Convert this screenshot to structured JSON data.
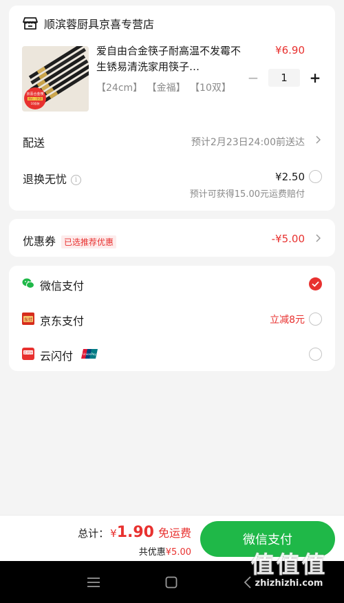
{
  "store": {
    "name": "顺滨蓉厨具京喜专营店",
    "icon": "store-icon"
  },
  "product": {
    "title": "爱自由合金筷子耐高温不发霉不生锈易清洗家用筷子…",
    "specs": [
      "【24cm】",
      "【金福】",
      "【10双】"
    ],
    "price": "¥6.90",
    "quantity": "1",
    "minus": "−",
    "plus": "+",
    "image_badge_lines": [
      "京喜合金筷",
      "原价 | 防滑",
      "10双装"
    ]
  },
  "delivery": {
    "label": "配送",
    "value": "预计2月23日24:00前送达"
  },
  "return_service": {
    "label": "退换无忧",
    "info": "i",
    "price": "¥2.50",
    "note": "预计可获得15.00元运费赔付"
  },
  "coupon": {
    "label": "优惠券",
    "tag": "已选推荐优惠",
    "value": "-¥5.00"
  },
  "payment": {
    "options": [
      {
        "label": "微信支付",
        "icon": "wechat-pay-icon",
        "promo": "",
        "selected": true
      },
      {
        "label": "京东支付",
        "icon": "jd-pay-icon",
        "promo": "立减8元",
        "selected": false
      },
      {
        "label": "云闪付",
        "icon": "unionpay-quickpass-icon",
        "promo": "",
        "selected": false
      }
    ],
    "jd_icon_text": "东付",
    "ysf_icon_text": "云闪付",
    "unionpay_badge_text": "UnionPay"
  },
  "footer": {
    "total_label": "总计：",
    "currency": "¥",
    "total_value": "1.90",
    "free_shipping": "免运费",
    "saved_prefix": "共优惠",
    "saved_value": "¥5.00",
    "pay_button": "微信支付"
  },
  "watermark": {
    "big": "值值值",
    "small": "zhizhizhi.com"
  },
  "colors": {
    "accent_red": "#e8312f",
    "wechat_green": "#1fb848",
    "jd_red": "#d62c1c"
  }
}
